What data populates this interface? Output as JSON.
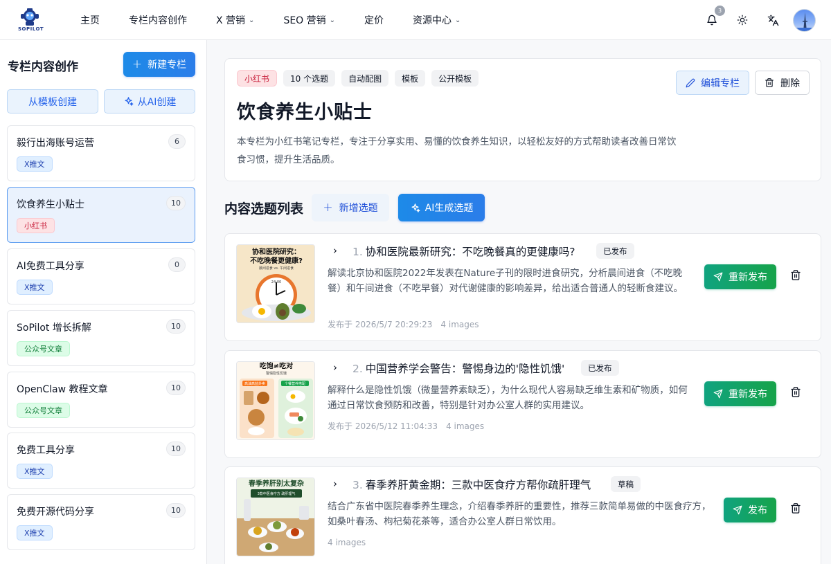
{
  "brand": {
    "logo_text": "SOPILOT"
  },
  "nav": {
    "items": [
      {
        "label": "主页",
        "dropdown": false
      },
      {
        "label": "专栏内容创作",
        "dropdown": false
      },
      {
        "label": "X 营销",
        "dropdown": true
      },
      {
        "label": "SEO 营销",
        "dropdown": true
      },
      {
        "label": "定价",
        "dropdown": false
      },
      {
        "label": "资源中心",
        "dropdown": true
      }
    ],
    "notification_count": "3"
  },
  "sidebar": {
    "title": "专栏内容创作",
    "new_button": "新建专栏",
    "from_template": "从模板创建",
    "from_ai": "从AI创建",
    "columns": [
      {
        "name": "毅行出海账号运营",
        "count": "6",
        "tag": "X推文",
        "tag_type": "x"
      },
      {
        "name": "饮食养生小贴士",
        "count": "10",
        "tag": "小红书",
        "tag_type": "red",
        "active": true
      },
      {
        "name": "AI免费工具分享",
        "count": "0",
        "tag": "X推文",
        "tag_type": "x"
      },
      {
        "name": "SoPilot 增长拆解",
        "count": "10",
        "tag": "公众号文章",
        "tag_type": "green"
      },
      {
        "name": "OpenClaw 教程文章",
        "count": "10",
        "tag": "公众号文章",
        "tag_type": "green"
      },
      {
        "name": "免费工具分享",
        "count": "10",
        "tag": "X推文",
        "tag_type": "x"
      },
      {
        "name": "免费开源代码分享",
        "count": "10",
        "tag": "X推文",
        "tag_type": "x"
      }
    ]
  },
  "column": {
    "chips": [
      "小红书",
      "10 个选题",
      "自动配图",
      "模板",
      "公开模板"
    ],
    "title": "饮食养生小贴士",
    "description": "本专栏为小红书笔记专栏，专注于分享实用、易懂的饮食养生知识，以轻松友好的方式帮助读者改善日常饮食习惯，提升生活品质。",
    "edit_button": "编辑专栏",
    "delete_button": "删除"
  },
  "topics_section": {
    "title": "内容选题列表",
    "add_button": "新增选题",
    "ai_button": "AI生成选题"
  },
  "topics": [
    {
      "num": "1.",
      "title": "协和医院最新研究：不吃晚餐真的更健康吗?",
      "status": "已发布",
      "description": "解读北京协和医院2022年发表在Nature子刊的限时进食研究，分析晨间进食（不吃晚餐）和午间进食（不吃早餐）对代谢健康的影响差异，给出适合普通人的轻断食建议。",
      "published_at": "发布于 2026/5/7 20:29:23",
      "images": "4 images",
      "action": "重新发布",
      "thumb_text": {
        "title": "协和医院研究：不吃晚餐更健康?",
        "sub": "晨间进食 vs. 午间进食",
        "clock": "24:00"
      }
    },
    {
      "num": "2.",
      "title": "中国营养学会警告：警惕身边的'隐性饥饿'",
      "status": "已发布",
      "description": "解释什么是隐性饥饿（微量营养素缺乏），为什么现代人容易缺乏维生素和矿物质，如何通过日常饮食预防和改善，特别是针对办公室人群的实用建议。",
      "published_at": "发布于 2026/5/12 11:04:33",
      "images": "4 images",
      "action": "重新发布",
      "thumb_text": {
        "top": "吃饱≠吃对",
        "sub": "警惕隐性饥饿",
        "left": "高油高盐外卖",
        "right": "个餐营养搭配"
      }
    },
    {
      "num": "3.",
      "title": "春季养肝黄金期：三款中医食疗方帮你疏肝理气",
      "status": "草稿",
      "description": "结合广东省中医院春季养生理念，介绍春季养肝的重要性，推荐三款简单易做的中医食疗方，如桑叶春汤、枸杞菊花茶等，适合办公室人群日常饮用。",
      "published_at": "",
      "images": "4 images",
      "action": "发布",
      "thumb_text": {
        "title": "春季养肝别太复杂",
        "sub": "3款中医食疗方 疏肝理气"
      }
    }
  ]
}
